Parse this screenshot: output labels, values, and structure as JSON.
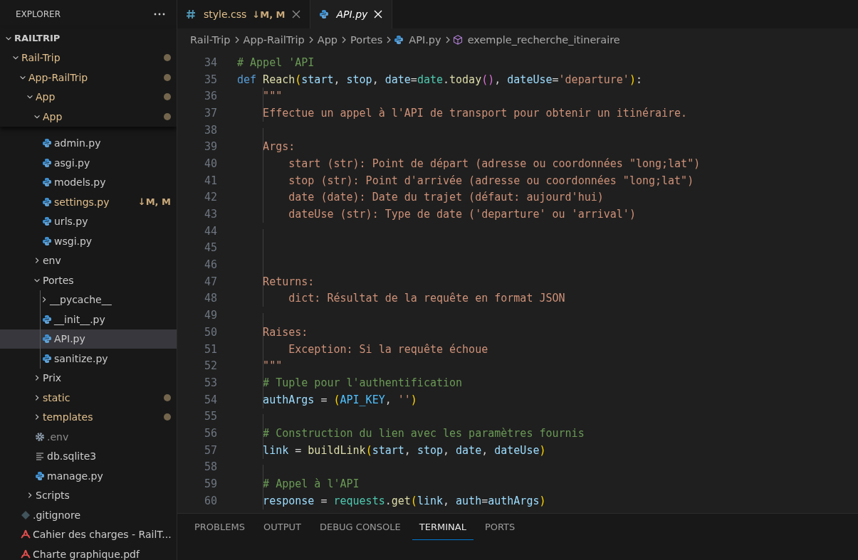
{
  "sidebar": {
    "title": "EXPLORER",
    "tree": [
      {
        "label": "RAILTRIP",
        "kind": "root",
        "expanded": true,
        "children": [
          {
            "label": "Rail-Trip",
            "kind": "folder",
            "expanded": true,
            "modified": true,
            "children": [
              {
                "label": "App-RailTrip",
                "kind": "folder",
                "expanded": true,
                "modified": true,
                "children": [
                  {
                    "label": "App",
                    "kind": "folder",
                    "expanded": true,
                    "modified": true,
                    "children": [
                      {
                        "label": "App",
                        "kind": "folder",
                        "expanded": true,
                        "modified": true,
                        "children": [
                          {
                            "label": "admin.py",
                            "kind": "python",
                            "selected": false
                          },
                          {
                            "label": "asgi.py",
                            "kind": "python",
                            "selected": false
                          },
                          {
                            "label": "models.py",
                            "kind": "python",
                            "selected": false
                          },
                          {
                            "label": "settings.py",
                            "kind": "python",
                            "modified": true,
                            "badge": "↓M, M",
                            "selected": false
                          },
                          {
                            "label": "urls.py",
                            "kind": "python",
                            "selected": false
                          },
                          {
                            "label": "wsgi.py",
                            "kind": "python",
                            "selected": false
                          }
                        ]
                      },
                      {
                        "label": "env",
                        "kind": "folder",
                        "expanded": false
                      },
                      {
                        "label": "Portes",
                        "kind": "folder",
                        "expanded": true,
                        "children": [
                          {
                            "label": "__pycache__",
                            "kind": "folder",
                            "expanded": false
                          },
                          {
                            "label": "__init__.py",
                            "kind": "python",
                            "selected": false
                          },
                          {
                            "label": "API.py",
                            "kind": "python",
                            "selected": true
                          },
                          {
                            "label": "sanitize.py",
                            "kind": "python",
                            "selected": false
                          }
                        ]
                      },
                      {
                        "label": "Prix",
                        "kind": "folder",
                        "expanded": false
                      },
                      {
                        "label": "static",
                        "kind": "folder",
                        "expanded": false,
                        "modified": true
                      },
                      {
                        "label": "templates",
                        "kind": "folder",
                        "expanded": false,
                        "modified": true
                      },
                      {
                        "label": ".env",
                        "kind": "settings",
                        "ignored": true,
                        "selected": false
                      },
                      {
                        "label": "db.sqlite3",
                        "kind": "text",
                        "selected": false
                      },
                      {
                        "label": "manage.py",
                        "kind": "python",
                        "selected": false
                      }
                    ]
                  },
                  {
                    "label": "Scripts",
                    "kind": "folder",
                    "expanded": false
                  }
                ]
              },
              {
                "label": ".gitignore",
                "kind": "git",
                "selected": false
              },
              {
                "label": "Cahier des charges - RailT...",
                "kind": "pdf",
                "selected": false
              },
              {
                "label": "Charte graphique.pdf",
                "kind": "pdf",
                "selected": false
              }
            ]
          }
        ]
      }
    ]
  },
  "tabs": [
    {
      "label": "style.css",
      "kind": "css",
      "badge": "↓M, M",
      "modified": true,
      "preview": false,
      "selected": false
    },
    {
      "label": "API.py",
      "kind": "python",
      "preview": true,
      "selected": true
    }
  ],
  "breadcrumb": [
    {
      "label": "Rail-Trip",
      "kind": "folder"
    },
    {
      "label": "App-RailTrip",
      "kind": "folder"
    },
    {
      "label": "App",
      "kind": "folder"
    },
    {
      "label": "Portes",
      "kind": "folder"
    },
    {
      "label": "API.py",
      "kind": "python"
    },
    {
      "label": "exemple_recherche_itineraire",
      "kind": "symbol"
    }
  ],
  "editor": {
    "lines": [
      {
        "number": "34",
        "tokens": [
          {
            "kind": "comment",
            "text": "# Appel 'API"
          }
        ]
      },
      {
        "number": "35",
        "tokens": [
          {
            "kind": "keyword",
            "text": "def"
          },
          {
            "kind": "function",
            "text": " Reach"
          },
          {
            "kind": "bracket1",
            "text": "("
          },
          {
            "kind": "param",
            "text": "start"
          },
          {
            "kind": "plain",
            "text": ", "
          },
          {
            "kind": "param",
            "text": "stop"
          },
          {
            "kind": "plain",
            "text": ", "
          },
          {
            "kind": "param",
            "text": "date"
          },
          {
            "kind": "plain",
            "text": "="
          },
          {
            "kind": "class",
            "text": "date"
          },
          {
            "kind": "plain",
            "text": "."
          },
          {
            "kind": "function",
            "text": "today"
          },
          {
            "kind": "bracket2",
            "text": "()"
          },
          {
            "kind": "plain",
            "text": ", "
          },
          {
            "kind": "param",
            "text": "dateUse"
          },
          {
            "kind": "plain",
            "text": "="
          },
          {
            "kind": "string",
            "text": "'departure'"
          },
          {
            "kind": "bracket1",
            "text": ")"
          },
          {
            "kind": "plain",
            "text": ":"
          }
        ]
      },
      {
        "number": "36",
        "tokens": [
          {
            "kind": "string",
            "text": "    \"\"\""
          }
        ]
      },
      {
        "number": "37",
        "tokens": [
          {
            "kind": "string",
            "text": "    Effectue un appel à l'API de transport pour obtenir un itinéraire."
          }
        ]
      },
      {
        "number": "38"
      },
      {
        "number": "39",
        "tokens": [
          {
            "kind": "string",
            "text": "    Args:"
          }
        ]
      },
      {
        "number": "40",
        "tokens": [
          {
            "kind": "string",
            "text": "        start (str): Point de départ (adresse ou coordonnées \"long;lat\")"
          }
        ]
      },
      {
        "number": "41",
        "tokens": [
          {
            "kind": "string",
            "text": "        stop (str): Point d'arrivée (adresse ou coordonnées \"long;lat\")"
          }
        ]
      },
      {
        "number": "42",
        "tokens": [
          {
            "kind": "string",
            "text": "        date (date): Date du trajet (défaut: aujourd'hui)"
          }
        ]
      },
      {
        "number": "43",
        "tokens": [
          {
            "kind": "string",
            "text": "        dateUse (str): Type de date ('departure' ou 'arrival')"
          }
        ]
      },
      {
        "number": "44"
      },
      {
        "number": "45"
      },
      {
        "number": "46"
      },
      {
        "number": "47",
        "tokens": [
          {
            "kind": "string",
            "text": "    Returns:"
          }
        ]
      },
      {
        "number": "48",
        "tokens": [
          {
            "kind": "string",
            "text": "        dict: Résultat de la requête en format JSON"
          }
        ]
      },
      {
        "number": "49"
      },
      {
        "number": "50",
        "tokens": [
          {
            "kind": "string",
            "text": "    Raises:"
          }
        ]
      },
      {
        "number": "51",
        "tokens": [
          {
            "kind": "string",
            "text": "        Exception: Si la requête échoue"
          }
        ]
      },
      {
        "number": "52",
        "tokens": [
          {
            "kind": "string",
            "text": "    \"\"\""
          }
        ]
      },
      {
        "number": "53",
        "tokens": [
          {
            "kind": "comment",
            "text": "    # Tuple pour l'authentification"
          }
        ]
      },
      {
        "number": "54",
        "tokens": [
          {
            "kind": "param",
            "text": "    authArgs"
          },
          {
            "kind": "plain",
            "text": " = "
          },
          {
            "kind": "bracket1",
            "text": "("
          },
          {
            "kind": "constant",
            "text": "API_KEY"
          },
          {
            "kind": "plain",
            "text": ", "
          },
          {
            "kind": "string",
            "text": "''"
          },
          {
            "kind": "bracket1",
            "text": ")"
          }
        ]
      },
      {
        "number": "55"
      },
      {
        "number": "56",
        "tokens": [
          {
            "kind": "comment",
            "text": "    # Construction du lien avec les paramètres fournis"
          }
        ]
      },
      {
        "number": "57",
        "tokens": [
          {
            "kind": "param",
            "text": "    link"
          },
          {
            "kind": "plain",
            "text": " = "
          },
          {
            "kind": "function",
            "text": "buildLink"
          },
          {
            "kind": "bracket1",
            "text": "("
          },
          {
            "kind": "param",
            "text": "start"
          },
          {
            "kind": "plain",
            "text": ", "
          },
          {
            "kind": "param",
            "text": "stop"
          },
          {
            "kind": "plain",
            "text": ", "
          },
          {
            "kind": "param",
            "text": "date"
          },
          {
            "kind": "plain",
            "text": ", "
          },
          {
            "kind": "param",
            "text": "dateUse"
          },
          {
            "kind": "bracket1",
            "text": ")"
          }
        ]
      },
      {
        "number": "58"
      },
      {
        "number": "59",
        "tokens": [
          {
            "kind": "comment",
            "text": "    # Appel à l'API"
          }
        ]
      },
      {
        "number": "60",
        "tokens": [
          {
            "kind": "param",
            "text": "    response"
          },
          {
            "kind": "plain",
            "text": " = "
          },
          {
            "kind": "class",
            "text": "requests"
          },
          {
            "kind": "plain",
            "text": "."
          },
          {
            "kind": "function",
            "text": "get"
          },
          {
            "kind": "bracket1",
            "text": "("
          },
          {
            "kind": "param",
            "text": "link"
          },
          {
            "kind": "plain",
            "text": ", "
          },
          {
            "kind": "param",
            "text": "auth"
          },
          {
            "kind": "plain",
            "text": "="
          },
          {
            "kind": "param",
            "text": "authArgs"
          },
          {
            "kind": "bracket1",
            "text": ")"
          }
        ]
      }
    ]
  },
  "panel": {
    "tabs": [
      {
        "label": "PROBLEMS",
        "selected": false
      },
      {
        "label": "OUTPUT",
        "selected": false
      },
      {
        "label": "DEBUG CONSOLE",
        "selected": false
      },
      {
        "label": "TERMINAL",
        "selected": true
      },
      {
        "label": "PORTS",
        "selected": false
      }
    ]
  }
}
